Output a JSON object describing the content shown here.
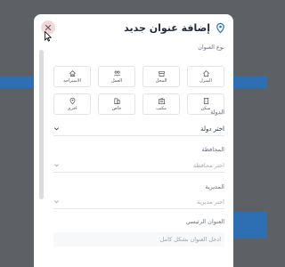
{
  "modal": {
    "title": "إضافة عنوان جديد",
    "close_glyph": "✕"
  },
  "address_type": {
    "label": "نوع العنوان",
    "items": [
      {
        "label": "المنزل",
        "icon": "house-icon"
      },
      {
        "label": "المحل",
        "icon": "shop-icon"
      },
      {
        "label": "العمل",
        "icon": "people-icon"
      },
      {
        "label": "الاستراحة",
        "icon": "rest-house-icon"
      },
      {
        "label": "سكن",
        "icon": "building-icon"
      },
      {
        "label": "مكتب",
        "icon": "office-icon"
      },
      {
        "label": "خاص",
        "icon": "private-building-icon"
      },
      {
        "label": "اخرى",
        "icon": "location-pin-icon"
      }
    ]
  },
  "country": {
    "label": "الدولة",
    "value": "اختر دولة"
  },
  "governorate": {
    "label": "المحافظة",
    "placeholder": "اختر محافظة"
  },
  "directorate": {
    "label": "المديرية",
    "placeholder": "اختر مديرية"
  },
  "main_address": {
    "label": "العنوان الرئيسي",
    "placeholder": "ادخل العنوان بشكل كامل"
  },
  "colors": {
    "accent": "#2e6fb4",
    "overlay": "#5d6166",
    "close_bg": "#f3d8da"
  }
}
